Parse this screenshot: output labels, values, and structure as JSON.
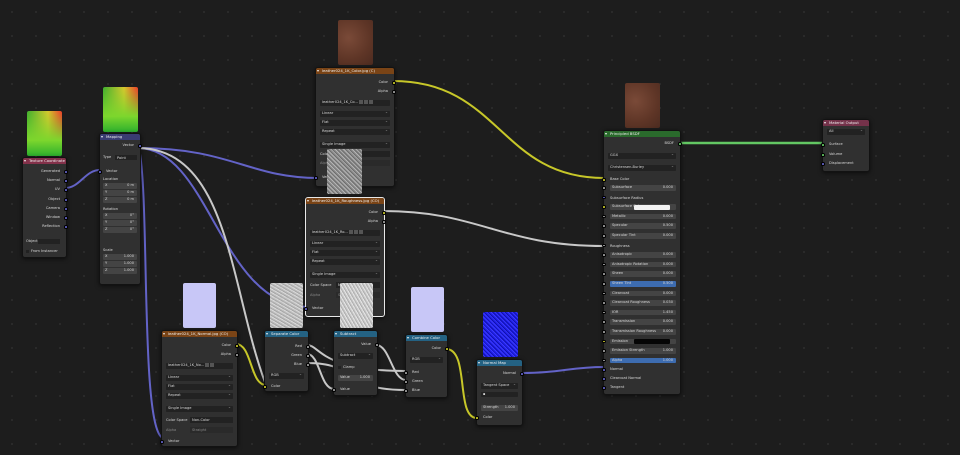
{
  "nodes": {
    "texcoord": {
      "title": "Texture Coordinate",
      "outputs": [
        "Generated",
        "Normal",
        "UV",
        "Object",
        "Camera",
        "Window",
        "Reflection"
      ],
      "object_label": "Object",
      "from_instancer": "From Instancer"
    },
    "mapping": {
      "title": "Mapping",
      "output": "Vector",
      "type_label": "Type",
      "type_value": "Point",
      "vector": "Vector",
      "location": "Location",
      "location_values": [
        "0 m",
        "0 m",
        "0 m"
      ],
      "rotation": "Rotation",
      "rotation_values": [
        "0°",
        "0°",
        "0°"
      ],
      "scale": "Scale",
      "scale_values": [
        "1.000",
        "1.000",
        "1.000"
      ],
      "xyz": [
        "X",
        "Y",
        "Z"
      ]
    },
    "colortex": {
      "title": "leather024_1K_Color.jpg (C)",
      "outputs": [
        "Color",
        "Alpha"
      ],
      "image_name": "leather024_1K_Co...",
      "interp": "Linear",
      "proj": "Flat",
      "ext": "Repeat",
      "source": "Single Image",
      "colorspace_label": "Color Space",
      "colorspace_value": "sRGB",
      "alpha_label": "Alpha",
      "alpha_value": "Straight",
      "input": "Vector"
    },
    "roughtex": {
      "title": "leather024_1K_Roughness.jpg (CO)",
      "outputs": [
        "Color",
        "Alpha"
      ],
      "image_name": "leather024_1K_Ro...",
      "interp": "Linear",
      "proj": "Flat",
      "ext": "Repeat",
      "source": "Single Image",
      "colorspace_label": "Color Space",
      "colorspace_value": "Non-Color",
      "alpha_label": "Alpha",
      "alpha_value": "Straight",
      "input": "Vector"
    },
    "normaltex": {
      "title": "leather024_1K_Normal.jpg (CO)",
      "outputs": [
        "Color",
        "Alpha"
      ],
      "image_name": "leather024_1K_No...",
      "interp": "Linear",
      "proj": "Flat",
      "ext": "Repeat",
      "source": "Single Image",
      "colorspace_label": "Color Space",
      "colorspace_value": "Non-Color",
      "alpha_label": "Alpha",
      "alpha_value": "Straight",
      "input": "Vector"
    },
    "separate": {
      "title": "Separate Color",
      "outputs": [
        "Red",
        "Green",
        "Blue"
      ],
      "mode": "RGB",
      "input": "Color"
    },
    "subtract": {
      "title": "Subtract",
      "output": "Value",
      "op": "Subtract",
      "clamp": "Clamp",
      "value_label": "Value",
      "value": "1.000",
      "input": "Value"
    },
    "combine": {
      "title": "Combine Color",
      "output": "Color",
      "mode": "RGB",
      "inputs": [
        "Red",
        "Green",
        "Blue"
      ]
    },
    "normalmap": {
      "title": "Normal Map",
      "output": "Normal",
      "space": "Tangent Space",
      "strength_label": "Strength",
      "strength_value": "1.000",
      "input": "Color"
    },
    "bsdf": {
      "title": "Principled BSDF",
      "output": "BSDF",
      "distribution": "GGX",
      "subsurface_method": "Christensen-Burley",
      "base_color": "Base Color",
      "sliders": [
        {
          "label": "Subsurface",
          "value": "0.000"
        },
        {
          "label": "Subsurface Radius",
          "value": ""
        },
        {
          "label": "Subsurface Color",
          "value": ""
        },
        {
          "label": "Metallic",
          "value": "0.000"
        },
        {
          "label": "Specular",
          "value": "0.500"
        },
        {
          "label": "Specular Tint",
          "value": "0.000"
        },
        {
          "label": "Roughness",
          "value": ""
        },
        {
          "label": "Anisotropic",
          "value": "0.000"
        },
        {
          "label": "Anisotropic Rotation",
          "value": "0.000"
        },
        {
          "label": "Sheen",
          "value": "0.000"
        },
        {
          "label": "Sheen Tint",
          "value": "0.500"
        },
        {
          "label": "Clearcoat",
          "value": "0.000"
        },
        {
          "label": "Clearcoat Roughness",
          "value": "0.030"
        },
        {
          "label": "IOR",
          "value": "1.450"
        },
        {
          "label": "Transmission",
          "value": "0.000"
        },
        {
          "label": "Transmission Roughness",
          "value": "0.000"
        },
        {
          "label": "Emission",
          "value": ""
        },
        {
          "label": "Emission Strength",
          "value": "1.000"
        },
        {
          "label": "Alpha",
          "value": "1.000"
        }
      ],
      "tail_inputs": [
        "Normal",
        "Clearcoat Normal",
        "Tangent"
      ]
    },
    "output": {
      "title": "Material Output",
      "target": "All",
      "inputs": [
        "Surface",
        "Volume",
        "Displacement"
      ]
    }
  },
  "colors": {
    "wire_yellow": "#c7c729",
    "wire_gray": "#c8c8c8",
    "wire_purple": "#6363c7",
    "wire_green": "#63c763",
    "header_texture": "#7a4416",
    "header_vector": "#3a3c72",
    "header_converter": "#246283",
    "header_shader": "#2a6a2c",
    "header_output": "#74324a"
  }
}
